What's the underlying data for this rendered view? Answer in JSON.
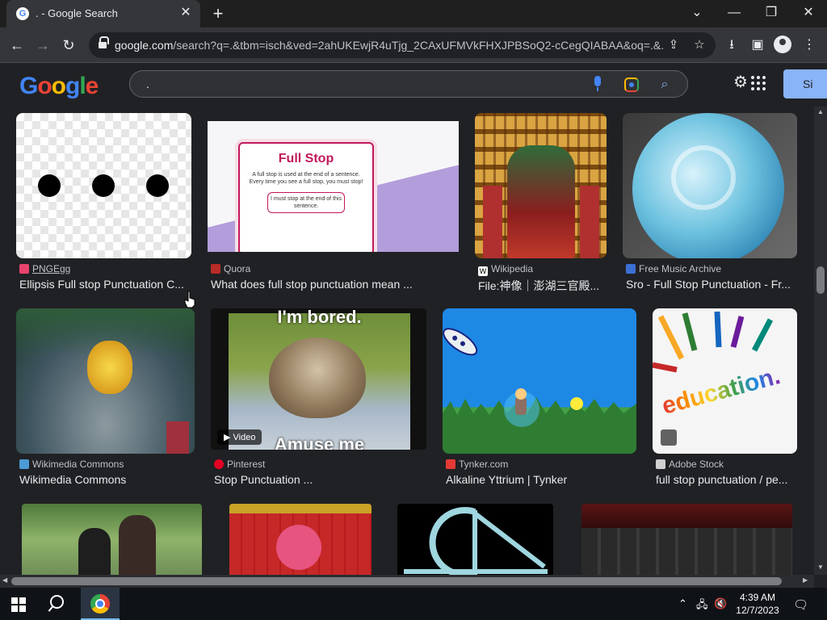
{
  "browser": {
    "tab": {
      "favicon": "google-g-icon",
      "title": ". - Google Search",
      "close": "✕"
    },
    "new_tab": "+",
    "window_controls": {
      "dropdown": "⌄",
      "minimize": "—",
      "restore": "❐",
      "close": "✕"
    },
    "nav": {
      "back": "←",
      "forward": "→",
      "reload": "↻"
    },
    "url_host": "google.com",
    "url_path": "/search?q=.&tbm=isch&ved=2ahUKEwjR4uTjg_2CAxUFMVkFHXJPBSoQ2-cCegQIABAA&oq=.&...",
    "omni_icons": {
      "share": "⇪",
      "bookmark": "☆"
    },
    "toolbar_icons": {
      "download": "⭳",
      "sidebar": "▣",
      "menu": "⋮"
    }
  },
  "google": {
    "logo_letters": [
      "G",
      "o",
      "o",
      "g",
      "l",
      "e"
    ],
    "logo_colors": [
      "#4285f4",
      "#ea4335",
      "#fbbc04",
      "#4285f4",
      "#34a853",
      "#ea4335"
    ],
    "query": ".",
    "search_icon": "⌕",
    "settings_icon": "⚙",
    "signin_label": "Si"
  },
  "results": [
    {
      "source": "PNGEgg",
      "title": "Ellipsis Full stop Punctuation C...",
      "favicon_color": "#e8446e",
      "kind": "ellipsis",
      "video": false
    },
    {
      "source": "Quora",
      "title": "What does full stop punctuation mean ...",
      "favicon_color": "#b92b27",
      "kind": "fullstop",
      "video": false,
      "card_heading": "Full Stop",
      "card_body": "A full stop is used at the end of a sentence. Every time you see a full stop, you must stop!",
      "card_bubble": "I must stop at the end of this sentence."
    },
    {
      "source": "Wikipedia",
      "title": "File:神像｜澎湖三官殿...",
      "favicon_color": "#ffffff",
      "kind": "shrine",
      "video": false
    },
    {
      "source": "Free Music Archive",
      "title": "Sro - Full Stop Punctuation - Fr...",
      "favicon_color": "#3b6fd4",
      "kind": "fma",
      "video": false
    },
    {
      "source": "Wikimedia Commons",
      "title": "Wikimedia Commons",
      "favicon_color": "#4c9bd6",
      "kind": "liondance",
      "video": false
    },
    {
      "source": "Pinterest",
      "title": "Stop Punctuation ...",
      "favicon_color": "#e60023",
      "kind": "cat",
      "video": true,
      "video_label": "Video",
      "meme_top": "I'm bored.",
      "meme_bottom": "Amuse me"
    },
    {
      "source": "Tynker.com",
      "title": "Alkaline Yttrium | Tynker",
      "favicon_color": "#e53935",
      "kind": "tynker",
      "video": false
    },
    {
      "source": "Adobe Stock",
      "title": "full stop punctuation / pe...",
      "favicon_color": "#d0d0d0",
      "kind": "education",
      "video": false,
      "image_word": "education."
    }
  ],
  "taskbar": {
    "time": "4:39 AM",
    "date": "12/7/2023",
    "tray_chevron": "⌃",
    "tray_network": "🖧",
    "tray_volume": "🔇",
    "notifications": "🗨"
  }
}
